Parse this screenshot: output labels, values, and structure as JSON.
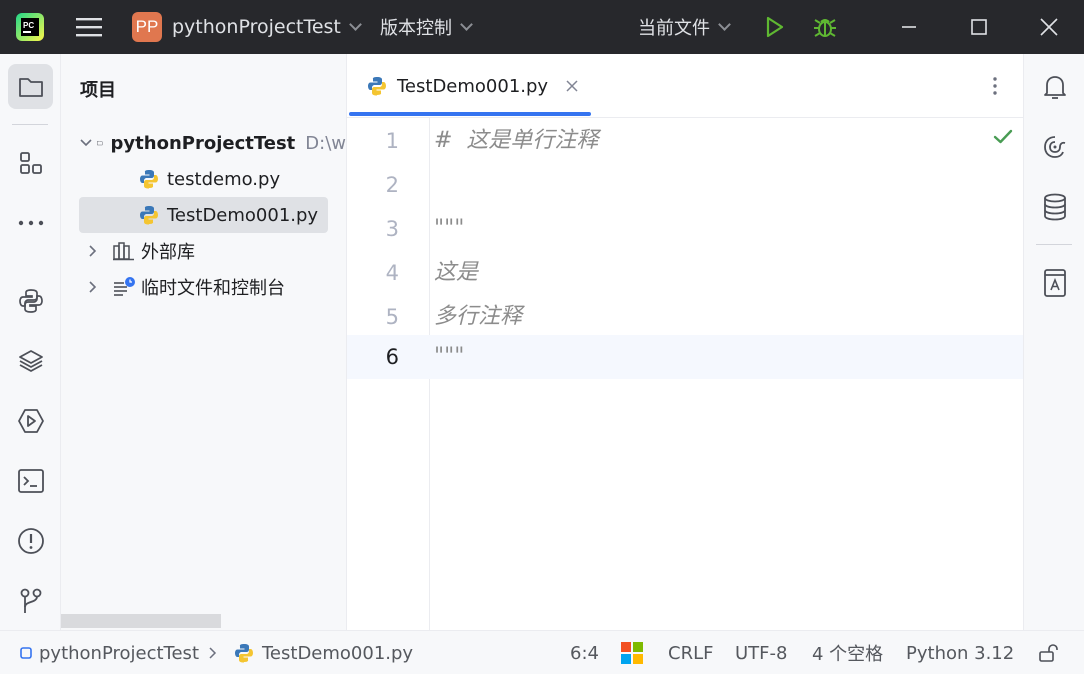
{
  "titlebar": {
    "project_badge": "PP",
    "project_name": "pythonProjectTest",
    "vcs_menu": "版本控制",
    "run_config": "当前文件"
  },
  "project_panel": {
    "title": "项目",
    "root_name": "pythonProjectTest",
    "root_path": "D:\\w",
    "files": [
      "testdemo.py",
      "TestDemo001.py"
    ],
    "external_libs": "外部库",
    "scratches": "临时文件和控制台"
  },
  "editor": {
    "tab_label": "TestDemo001.py",
    "lines": [
      {
        "num": "1",
        "code": "#  这是单行注释"
      },
      {
        "num": "2",
        "code": ""
      },
      {
        "num": "3",
        "code": "\"\"\""
      },
      {
        "num": "4",
        "code": "这是"
      },
      {
        "num": "5",
        "code": "多行注释"
      },
      {
        "num": "6",
        "code": "\"\"\""
      }
    ]
  },
  "statusbar": {
    "breadcrumb_project": "pythonProjectTest",
    "breadcrumb_file": "TestDemo001.py",
    "caret_position": "6:4",
    "line_separator": "CRLF",
    "encoding": "UTF-8",
    "indent": "4 个空格",
    "interpreter": "Python 3.12"
  },
  "colors": {
    "titlebar_bg": "#27282c",
    "accent": "#3574f0",
    "run_green": "#5fb832",
    "check_green": "#499c54",
    "project_badge": "#e0774f"
  }
}
